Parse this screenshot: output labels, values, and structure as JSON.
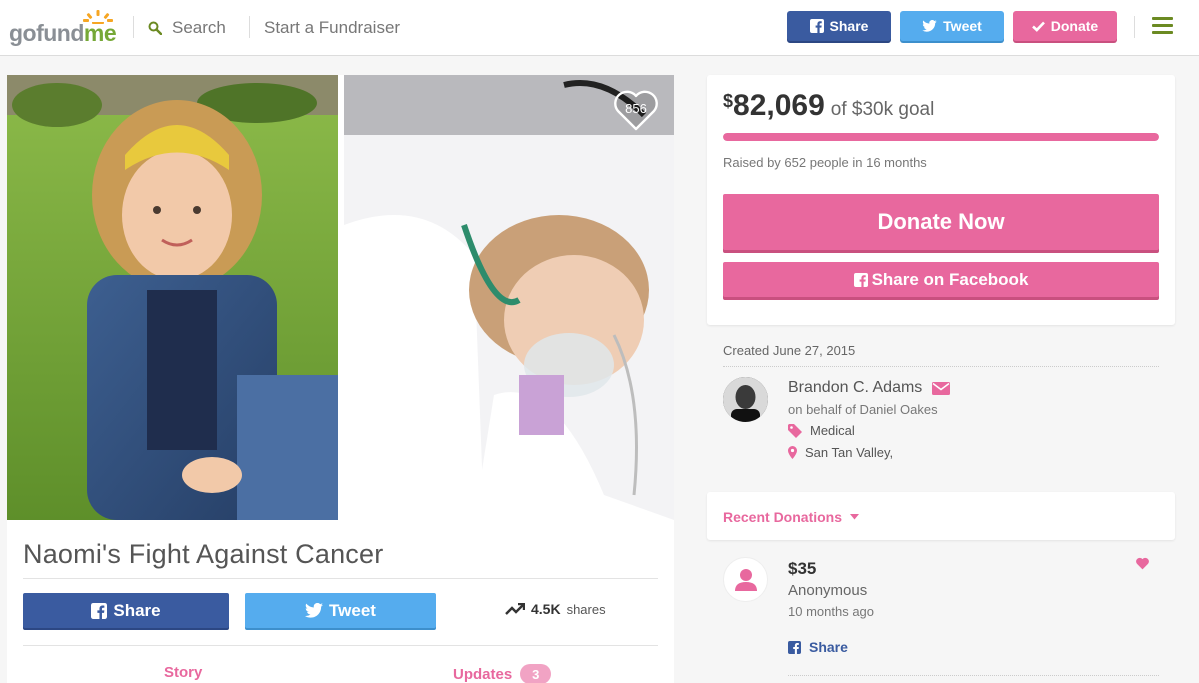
{
  "header": {
    "logo_text": "gofund",
    "logo_suffix": "me",
    "search_label": "Search",
    "start_label": "Start a Fundraiser",
    "share_label": "Share",
    "tweet_label": "Tweet",
    "donate_label": "Donate"
  },
  "campaign": {
    "heart_count": "856",
    "title": "Naomi's Fight Against Cancer",
    "share_label": "Share",
    "tweet_label": "Tweet",
    "shares_count": "4.5K",
    "shares_label": "shares",
    "tabs": {
      "story": "Story",
      "updates": "Updates",
      "updates_count": "3"
    }
  },
  "goal": {
    "currency": "$",
    "amount": "82,069",
    "of_goal": "of $30k goal",
    "progress_percent": 100,
    "raised_by": "Raised by 652 people in 16 months",
    "donate_now": "Donate Now",
    "share_facebook": "Share on Facebook"
  },
  "details": {
    "created": "Created June 27, 2015",
    "organizer": "Brandon C. Adams",
    "on_behalf": "on behalf of Daniel Oakes",
    "category": "Medical",
    "location": "San Tan Valley,"
  },
  "recent": {
    "title": "Recent Donations",
    "donations": [
      {
        "amount": "$35",
        "name": "Anonymous",
        "time": "10 months ago",
        "share_label": "Share"
      }
    ]
  },
  "colors": {
    "brand_pink": "#e8689e",
    "facebook_blue": "#3a5ba0",
    "twitter_blue": "#55acee",
    "logo_green": "#76a836"
  }
}
